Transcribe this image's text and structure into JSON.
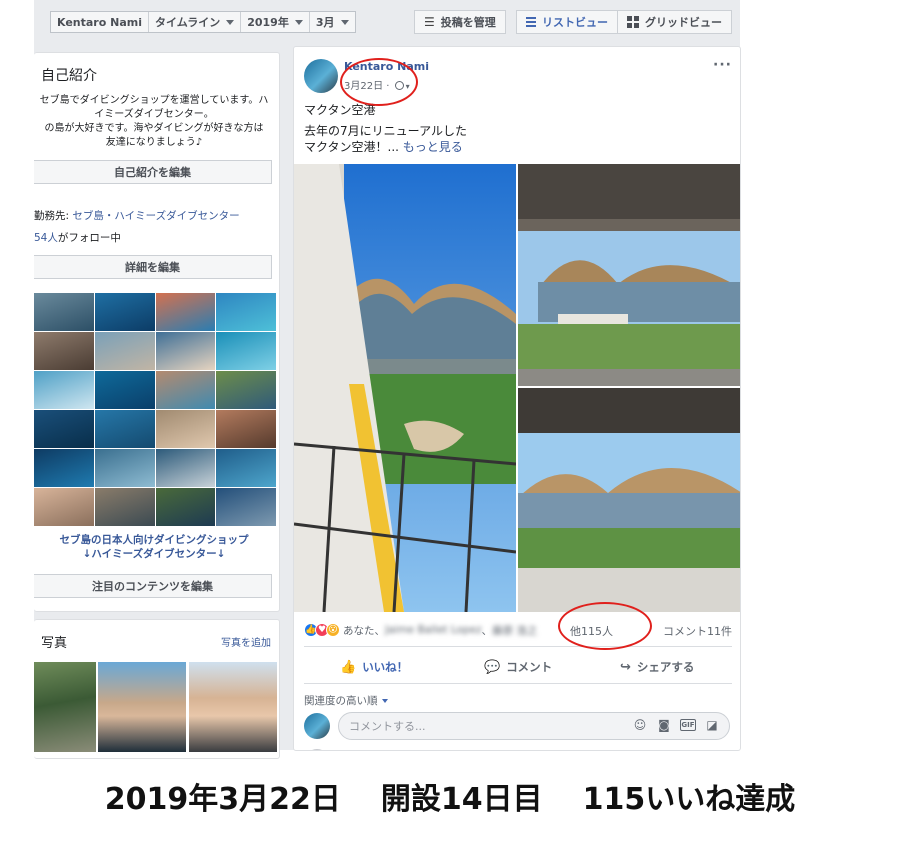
{
  "filter_bar": {
    "name": "Kentaro Nami",
    "timeline": "タイムライン",
    "year": "2019年",
    "month": "3月",
    "manage_posts": "投稿を管理",
    "list_view": "リストビュー",
    "grid_view": "グリッドビュー"
  },
  "intro": {
    "title": "自己紹介",
    "bio_lines": [
      "セブ島でダイビングショップを運営しています。ハ",
      "イミーズダイブセンター。",
      "の島が大好きです。海やダイビングが好きな方は",
      "友達になりましょう♪"
    ],
    "edit_intro": "自己紹介を編集",
    "work_prefix": "勤務先: ",
    "work_place": "セブ島・ハイミーズダイブセンター",
    "followers_count": "54人",
    "followers_suffix": "がフォロー中",
    "edit_details": "詳細を編集",
    "featured_caption_lines": [
      "セブ島の日本人向けダイビングショップ",
      "↓ハイミーズダイブセンター↓"
    ],
    "edit_featured": "注目のコンテンツを編集"
  },
  "photos": {
    "title": "写真",
    "add": "写真を追加"
  },
  "post": {
    "author": "Kentaro Nami",
    "date": "3月22日 · ",
    "location": "マクタン空港",
    "text_line1": "去年の7月にリニューアルした",
    "text_line2": "マクタン空港！... ",
    "see_more": "もっと見る",
    "reactions_names_prefix": "あなた、",
    "reactions_blurred_1": "Jaime Ballet Lopez",
    "reactions_blurred_2": "藤原 浩之",
    "reactions_sep": "、",
    "others": "他115人",
    "comment_count": "コメント11件",
    "like_label": "いいね！",
    "comment_label": "コメント",
    "share_label": "シェアする",
    "sort_label": "関連度の高い順",
    "comment_placeholder": "コメントする..."
  },
  "caption": {
    "date": "2019年3月22日",
    "day": "開設14日目",
    "likes": "115いいね達成"
  },
  "colors": {
    "fb_blue": "#4267b2",
    "link": "#385898",
    "annotation_red": "#e0201c"
  },
  "icons": [
    "chevron-down-icon",
    "manage-posts-icon",
    "list-view-icon",
    "grid-view-icon",
    "globe-icon",
    "more-options-icon",
    "like-reaction-icon",
    "love-reaction-icon",
    "wow-reaction-icon",
    "thumbs-up-icon",
    "comment-icon",
    "share-icon",
    "emoji-icon",
    "camera-icon",
    "gif-icon",
    "sticker-icon"
  ]
}
